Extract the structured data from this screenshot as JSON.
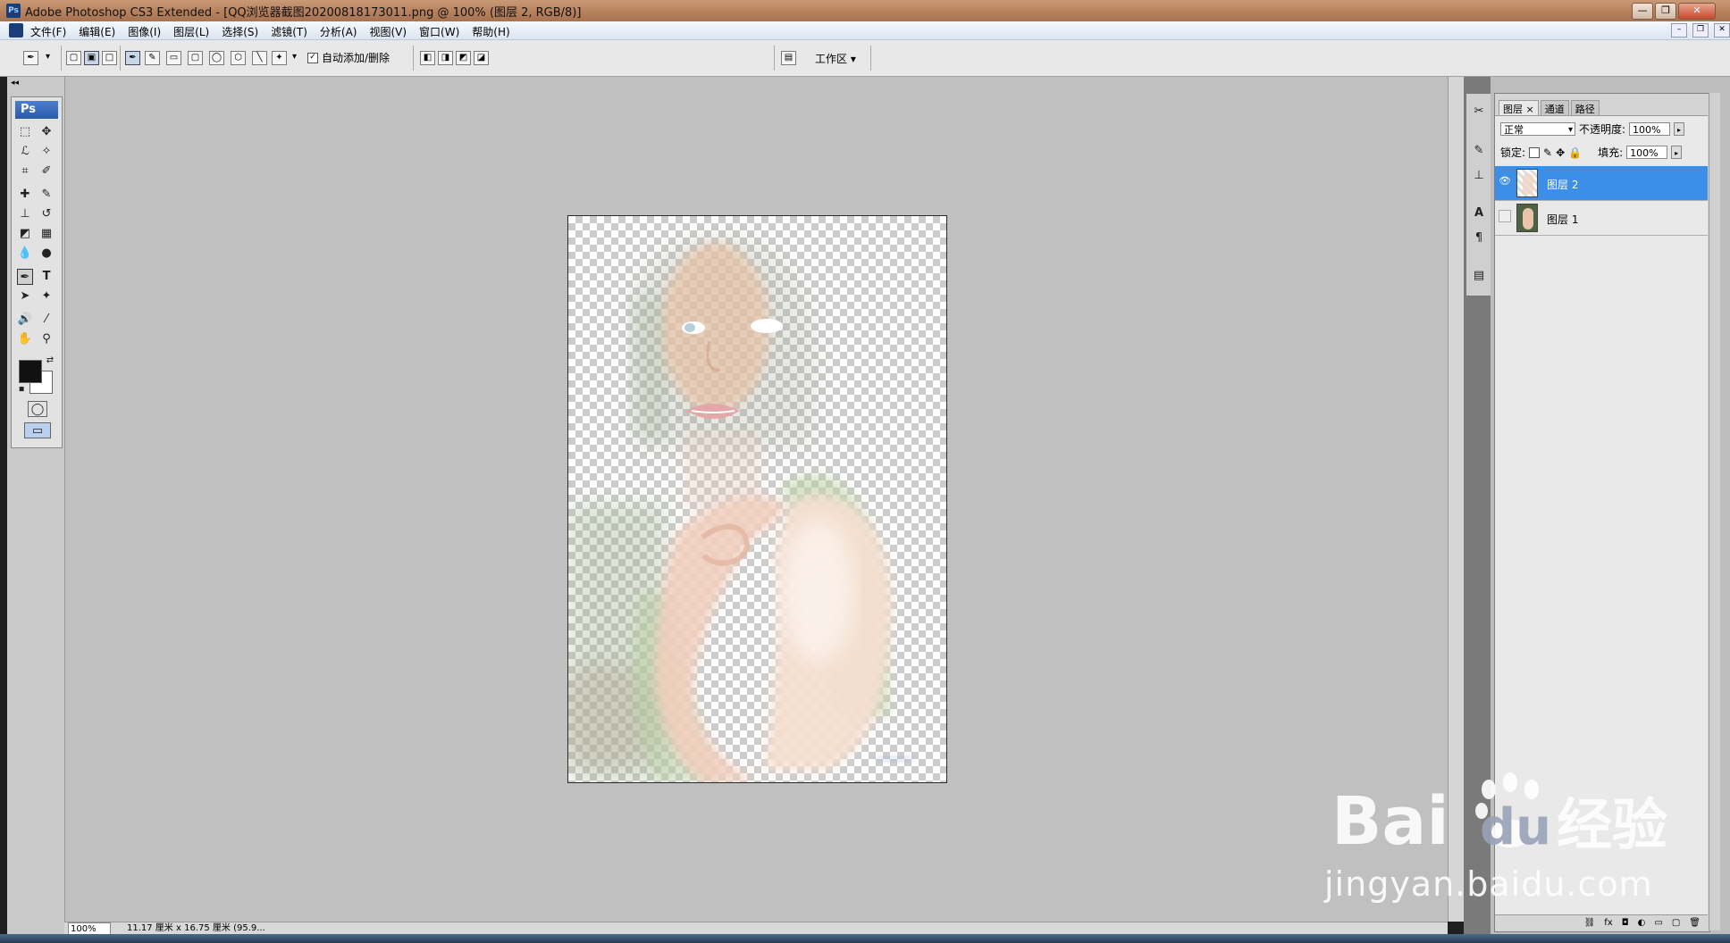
{
  "window": {
    "title": "Adobe Photoshop CS3 Extended - [QQ浏览器截图20200818173011.png @ 100% (图层 2, RGB/8)]",
    "app_icon": "Ps",
    "buttons": [
      "—",
      "❐",
      "✕"
    ]
  },
  "menubar": {
    "items": [
      "文件(F)",
      "编辑(E)",
      "图像(I)",
      "图层(L)",
      "选择(S)",
      "滤镜(T)",
      "分析(A)",
      "视图(V)",
      "窗口(W)",
      "帮助(H)"
    ],
    "doc_buttons": [
      "–",
      "❐",
      "✕"
    ]
  },
  "options_bar": {
    "auto_add_delete_label": "自动添加/删除",
    "auto_add_delete_checked": true,
    "workspace_label": "工作区 ▾"
  },
  "tools": {
    "logo": "Ps",
    "icons": [
      "marquee-icon",
      "move-icon",
      "lasso-icon",
      "magic-wand-icon",
      "crop-icon",
      "slice-icon",
      "healing-brush-icon",
      "brush-icon",
      "clone-stamp-icon",
      "history-brush-icon",
      "eraser-icon",
      "gradient-icon",
      "blur-icon",
      "dodge-icon",
      "pen-icon",
      "type-icon",
      "path-select-icon",
      "shape-icon",
      "notes-icon",
      "eyedropper-icon",
      "hand-icon",
      "zoom-icon"
    ],
    "foreground_color": "#111111",
    "background_color": "#ffffff"
  },
  "status_bar": {
    "zoom": "100%",
    "doc_info": "11.17 厘米 x 16.75 厘米 (95.9..."
  },
  "layers_panel": {
    "tabs": [
      "图层 ×",
      "通道",
      "路径"
    ],
    "blend_mode": "正常",
    "opacity_label": "不透明度:",
    "opacity_value": "100%",
    "lock_label": "锁定:",
    "fill_label": "填充:",
    "fill_value": "100%",
    "layers": [
      {
        "name": "图层 2",
        "visible": true,
        "selected": true
      },
      {
        "name": "图层 1",
        "visible": false,
        "selected": false
      }
    ],
    "footer_icons": [
      "link-icon",
      "fx-icon",
      "mask-icon",
      "adjustment-icon",
      "folder-icon",
      "new-layer-icon",
      "trash-icon"
    ]
  },
  "watermark": {
    "brand": "Bai",
    "brand2": "du",
    "cn": "经验",
    "url": "jingyan.baidu.com"
  },
  "colors": {
    "accent_selected": "#3d8ee6",
    "canvas_bg": "#c0c0c0"
  }
}
